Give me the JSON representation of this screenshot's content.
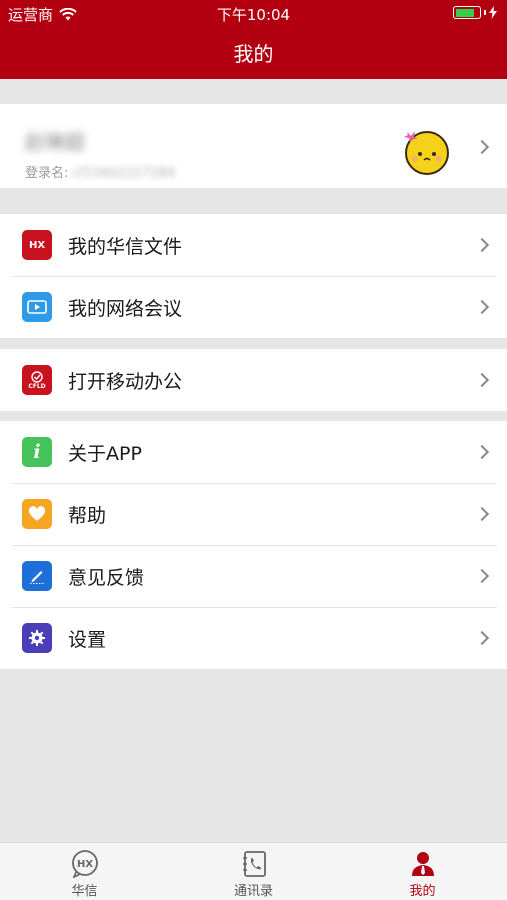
{
  "status_bar": {
    "carrier": "运营商",
    "time": "下午10:04",
    "battery_level_pct": 80
  },
  "header": {
    "title": "我的"
  },
  "profile": {
    "name": "赵琳超",
    "login_label": "登录名:",
    "login_value": "cf15602227284"
  },
  "menu_groups": [
    {
      "items": [
        {
          "label": "我的华信文件",
          "icon": "hx-file-icon",
          "icon_text": "HX",
          "color": "#c8131f"
        },
        {
          "label": "我的网络会议",
          "icon": "video-meeting-icon",
          "color": "#2f9ae8"
        }
      ]
    },
    {
      "items": [
        {
          "label": "打开移动办公",
          "icon": "cfld-office-icon",
          "icon_text": "CFLD",
          "color": "#c8131f"
        }
      ]
    },
    {
      "items": [
        {
          "label": "关于APP",
          "icon": "info-icon",
          "icon_text": "i",
          "color": "#45c35a"
        },
        {
          "label": "帮助",
          "icon": "heart-icon",
          "color": "#f5a623"
        },
        {
          "label": "意见反馈",
          "icon": "edit-icon",
          "color": "#1e6fd9"
        },
        {
          "label": "设置",
          "icon": "gear-icon",
          "color": "#4a3fb8"
        }
      ]
    }
  ],
  "tab_bar": {
    "tabs": [
      {
        "label": "华信",
        "icon": "hx-chat-icon",
        "active": false
      },
      {
        "label": "通讯录",
        "icon": "contacts-icon",
        "active": false
      },
      {
        "label": "我的",
        "icon": "user-icon",
        "active": true
      }
    ]
  },
  "colors": {
    "brand_red": "#b30010",
    "background": "#e6e6e6"
  }
}
